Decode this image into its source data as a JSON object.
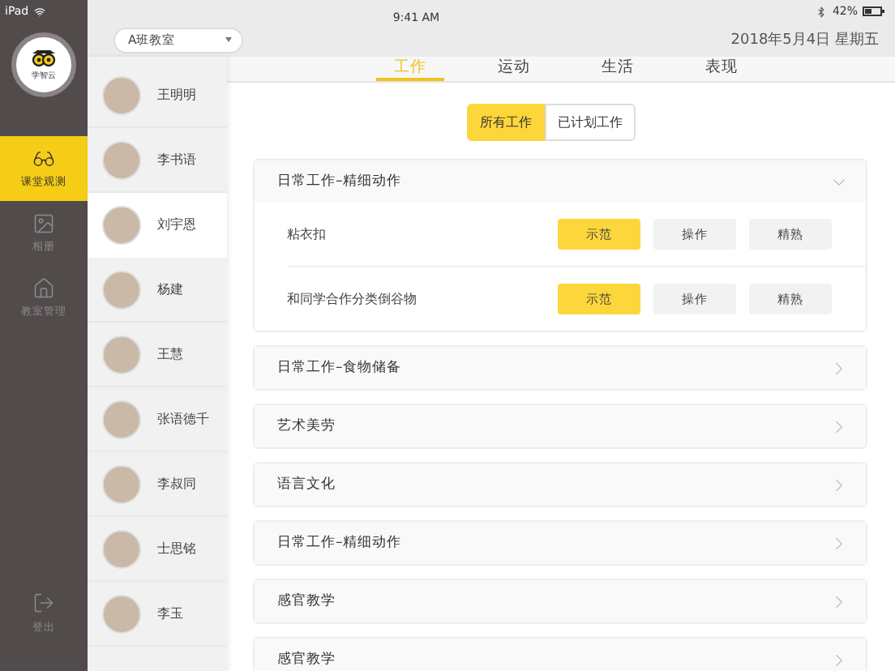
{
  "status_bar": {
    "device": "iPad",
    "time": "9:41 AM",
    "battery": "42%"
  },
  "nav": {
    "logo_text": "学智云",
    "items": [
      {
        "label": "课堂观测",
        "selected": true
      },
      {
        "label": "相册",
        "selected": false
      },
      {
        "label": "教室管理",
        "selected": false
      }
    ],
    "logout": "登出"
  },
  "header": {
    "classroom": "A班教室",
    "date": "2018年5月4日 星期五"
  },
  "students": [
    {
      "name": "王明明",
      "selected": false
    },
    {
      "name": "李书语",
      "selected": false
    },
    {
      "name": "刘宇恩",
      "selected": true
    },
    {
      "name": "杨建",
      "selected": false
    },
    {
      "name": "王慧",
      "selected": false
    },
    {
      "name": "张语德千",
      "selected": false
    },
    {
      "name": "李叔同",
      "selected": false
    },
    {
      "name": "士思铭",
      "selected": false
    },
    {
      "name": "李玉",
      "selected": false
    }
  ],
  "tabs": [
    {
      "label": "工作",
      "selected": true
    },
    {
      "label": "运动",
      "selected": false
    },
    {
      "label": "生活",
      "selected": false
    },
    {
      "label": "表现",
      "selected": false
    }
  ],
  "filter": [
    {
      "label": "所有工作",
      "selected": true
    },
    {
      "label": "已计划工作",
      "selected": false
    }
  ],
  "sections": [
    {
      "title": "日常工作–精细动作",
      "expanded": true,
      "items": [
        {
          "name": "粘衣扣",
          "levels": [
            {
              "label": "示范",
              "selected": true
            },
            {
              "label": "操作",
              "selected": false
            },
            {
              "label": "精熟",
              "selected": false
            }
          ]
        },
        {
          "name": "和同学合作分类倒谷物",
          "levels": [
            {
              "label": "示范",
              "selected": true
            },
            {
              "label": "操作",
              "selected": false
            },
            {
              "label": "精熟",
              "selected": false
            }
          ]
        }
      ]
    },
    {
      "title": "日常工作–食物储备",
      "expanded": false
    },
    {
      "title": "艺术美劳",
      "expanded": false
    },
    {
      "title": "语言文化",
      "expanded": false
    },
    {
      "title": "日常工作–精细动作",
      "expanded": false
    },
    {
      "title": "感官教学",
      "expanded": false
    },
    {
      "title": "感官教学",
      "expanded": false
    }
  ]
}
